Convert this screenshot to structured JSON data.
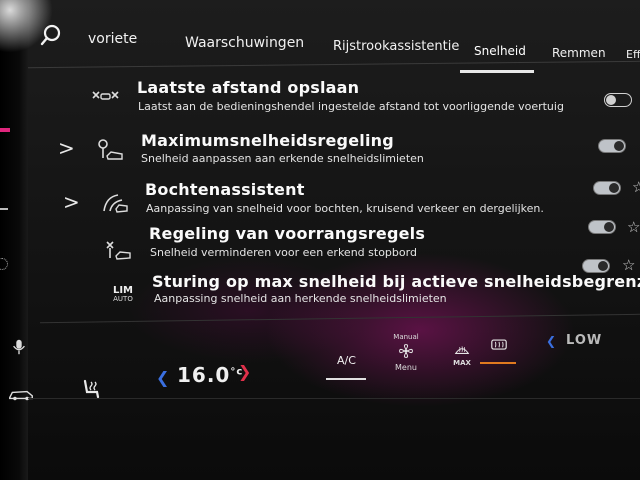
{
  "tabs": [
    {
      "label": "voriete"
    },
    {
      "label": "Waarschuwingen"
    },
    {
      "label": "Rijstrookassistentie"
    },
    {
      "label": "Snelheid"
    },
    {
      "label": "Remmen"
    },
    {
      "label": "Eff"
    }
  ],
  "active_tab": "Snelheid",
  "settings": [
    {
      "title": "Laatste afstand opslaan",
      "subtitle": "Laatst aan de bedieningshendel ingestelde afstand tot voorliggende voertuig",
      "toggle": "off",
      "icon": "distance-icon"
    },
    {
      "title": "Maximumsnelheidsregeling",
      "subtitle": "Snelheid aanpassen aan erkende snelheidslimieten",
      "toggle": "on",
      "icon": "speed-limit-icon"
    },
    {
      "title": "Bochtenassistent",
      "subtitle": "Aanpassing van snelheid voor bochten, kruisend verkeer en dergelijken.",
      "toggle": "on",
      "icon": "curve-assist-icon"
    },
    {
      "title": "Regeling van voorrangsregels",
      "subtitle": "Snelheid verminderen voor een erkend stopbord",
      "toggle": "on",
      "icon": "right-of-way-icon"
    },
    {
      "title": "Sturing op max snelheid bij actieve snelheidsbegrenzer",
      "subtitle": "Aanpassing snelheid aan herkende snelheidslimieten",
      "toggle": "on",
      "icon": "lim-auto-icon"
    }
  ],
  "lim_icon": {
    "top": "LIM",
    "bottom": "AUTO"
  },
  "climate": {
    "temperature": "16.0",
    "unit": "°c",
    "ac_label": "A/C",
    "fan_mode": "Manual",
    "menu_label": "Menu",
    "max_label": "MAX",
    "fan_level": "LOW"
  },
  "colors": {
    "accent": "#e0267d",
    "rear_defrost_active": "#e07a1f",
    "temp_arrow_left": "#3a6fe0",
    "temp_arrow_right": "#e0304a"
  }
}
